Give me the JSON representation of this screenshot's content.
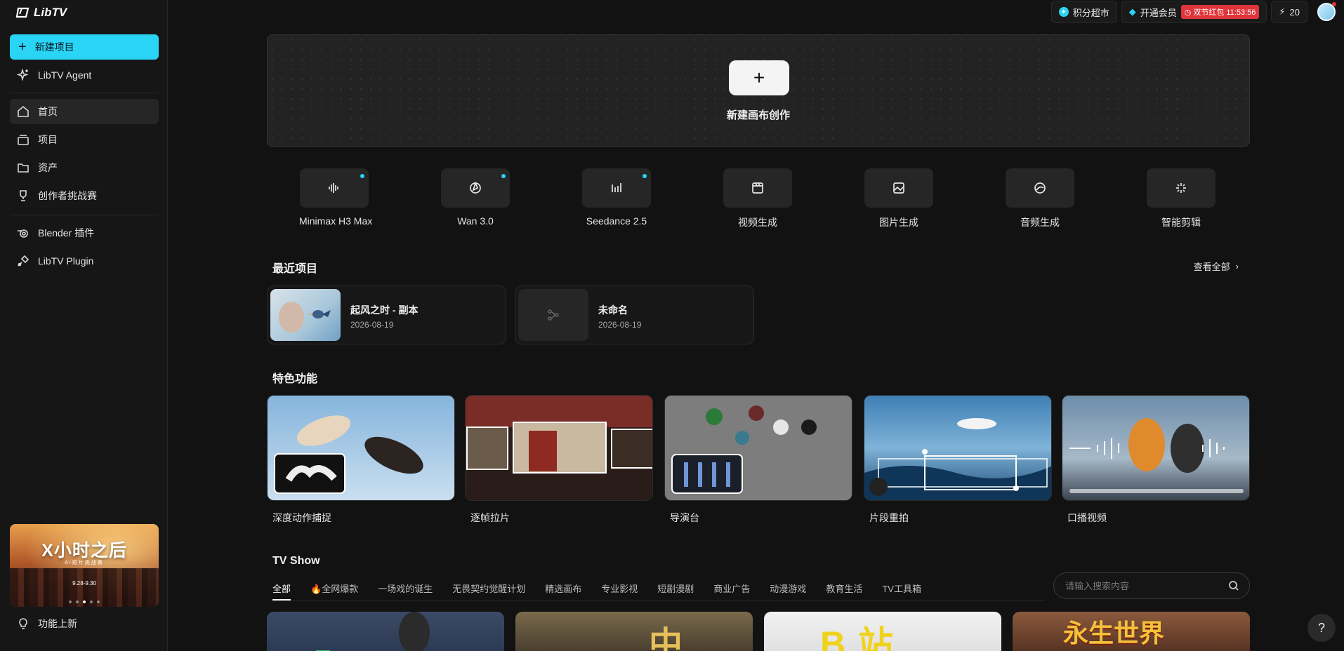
{
  "app": {
    "logo_text": "LibTV"
  },
  "sidebar": {
    "new_project": "新建项目",
    "agent": "LibTV Agent",
    "home": "首页",
    "projects": "项目",
    "assets": "资产",
    "challenge": "创作者挑战赛",
    "blender": "Blender 插件",
    "plugin": "LibTV Plugin",
    "whats_new": "功能上新",
    "promo": {
      "title": "X小时之后",
      "subtitle": "AI短片挑战赛",
      "date": "9.28-9.30"
    }
  },
  "topbar": {
    "points_mall": "积分超市",
    "membership": "开通会员",
    "promo_badge": "双节红包 11:53:56",
    "credits": "20"
  },
  "canvas": {
    "label": "新建画布创作"
  },
  "tools": [
    {
      "label": "Minimax H3 Max",
      "icon": "waveform-icon",
      "dot": true
    },
    {
      "label": "Wan 3.0",
      "icon": "aperture-icon",
      "dot": true
    },
    {
      "label": "Seedance 2.5",
      "icon": "bars-icon",
      "dot": true
    },
    {
      "label": "视频生成",
      "icon": "video-gen-icon",
      "dot": false
    },
    {
      "label": "图片生成",
      "icon": "image-gen-icon",
      "dot": false
    },
    {
      "label": "音频生成",
      "icon": "audio-gen-icon",
      "dot": false
    },
    {
      "label": "智能剪辑",
      "icon": "sparkle-icon",
      "dot": false
    }
  ],
  "recent": {
    "title": "最近项目",
    "view_all": "查看全部",
    "items": [
      {
        "name": "起风之时 - 副本",
        "date": "2026-08-19"
      },
      {
        "name": "未命名",
        "date": "2026-08-19"
      }
    ]
  },
  "features": {
    "title": "特色功能",
    "items": [
      {
        "label": "深度动作捕捉"
      },
      {
        "label": "逐帧拉片"
      },
      {
        "label": "导演台"
      },
      {
        "label": "片段重拍"
      },
      {
        "label": "口播视频"
      }
    ]
  },
  "tvshow": {
    "title": "TV Show",
    "tabs": [
      "全部",
      "🔥全网爆款",
      "一场戏的诞生",
      "无畏契约觉醒计划",
      "精选画布",
      "专业影视",
      "短剧漫剧",
      "商业广告",
      "动漫游戏",
      "教育生活",
      "TV工具箱"
    ],
    "search_placeholder": "请输入搜索内容",
    "cards": [
      "",
      "中",
      "B站",
      "永生世界"
    ]
  },
  "help": "?",
  "colors": {
    "accent": "#2ad4f5",
    "badge": "#e0343b",
    "bg": "#121212"
  }
}
